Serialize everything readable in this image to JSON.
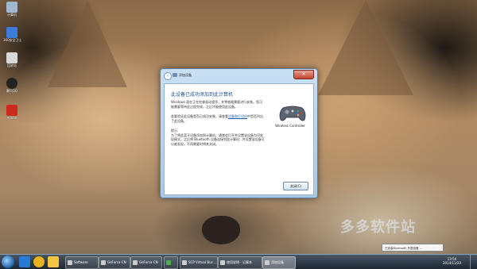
{
  "desktop": {
    "icons": [
      {
        "label": "计算机",
        "name": "computer",
        "color": "#9fb7cf"
      },
      {
        "label": "360安全卫士",
        "name": "security",
        "color": "#3c7bd9"
      },
      {
        "label": "回收站",
        "name": "recycle-bin",
        "color": "#d8d8d8"
      },
      {
        "label": "腾讯QQ",
        "name": "qq",
        "color": "#222222"
      },
      {
        "label": "Adobe",
        "name": "adobe",
        "color": "#cc2a1e"
      }
    ]
  },
  "dialog": {
    "title": "添加设备",
    "heading": "此设备已成功添加到此计算机",
    "para1": "Windows 现在正在检查驱动程序，并将根据需要进行安装。您可能需要等待此过程完成，之后才能使用此设备。",
    "para2a": "若要验证此设备是否已成功安装，请查看",
    "para2_link": "设备和打印机",
    "para2b": "中是否列出了此设备。",
    "para3": "提示\n为了将此蓝牙设备添加到计算机，通常会打开并设置该设备为可发现模式，之后将 Bluetooth 设备连接到此计算机...并设置该设备可以被发现，不再需要时将其关闭。",
    "device_label": "Wireless Controller",
    "next_button": "关闭(C)"
  },
  "taskbar": {
    "tasks": [
      {
        "label": "Software"
      },
      {
        "label": "GeForce-CN"
      },
      {
        "label": "GeForce-CN"
      },
      {
        "label": ""
      },
      {
        "label": "SCP Virtual Bus ..."
      },
      {
        "label": "使用说明 - 记事本"
      },
      {
        "label": "添加设备"
      }
    ],
    "clock_time": "13:54",
    "clock_date": "2014/11/20"
  },
  "popup": {
    "text": "已安装Bluetooth 外围设备 ..."
  },
  "watermark": {
    "text": "多多软件站"
  }
}
